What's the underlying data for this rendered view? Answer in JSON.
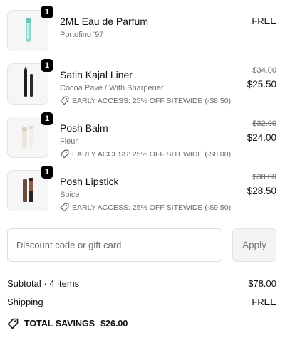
{
  "items": [
    {
      "quantity": "1",
      "name": "2ML Eau de Parfum",
      "variant": "Portofino '97",
      "price": "FREE",
      "image": "perfume-vial-icon"
    },
    {
      "quantity": "1",
      "name": "Satin Kajal Liner",
      "variant": "Cocoa Pavé / With Sharpener",
      "discount": "EARLY ACCESS: 25% OFF SITEWIDE (-$8.50)",
      "original_price": "$34.00",
      "price": "$25.50",
      "image": "eyeliner-pencil-icon"
    },
    {
      "quantity": "1",
      "name": "Posh Balm",
      "variant": "Fleur",
      "discount": "EARLY ACCESS: 25% OFF SITEWIDE (-$8.00)",
      "original_price": "$32.00",
      "price": "$24.00",
      "image": "balm-tubes-icon"
    },
    {
      "quantity": "1",
      "name": "Posh Lipstick",
      "variant": "Spice",
      "discount": "EARLY ACCESS: 25% OFF SITEWIDE (-$9.50)",
      "original_price": "$38.00",
      "price": "$28.50",
      "image": "lipstick-icon"
    }
  ],
  "discount_code": {
    "placeholder": "Discount code or gift card",
    "value": "",
    "apply_label": "Apply"
  },
  "summary": {
    "subtotal_label": "Subtotal · 4 items",
    "subtotal_value": "$78.00",
    "shipping_label": "Shipping",
    "shipping_value": "FREE",
    "savings_label": "TOTAL SAVINGS",
    "savings_value": "$26.00"
  },
  "colors": {
    "text": "#111111",
    "muted": "#707070",
    "badge": "#000000",
    "border": "#dcdcdc"
  }
}
